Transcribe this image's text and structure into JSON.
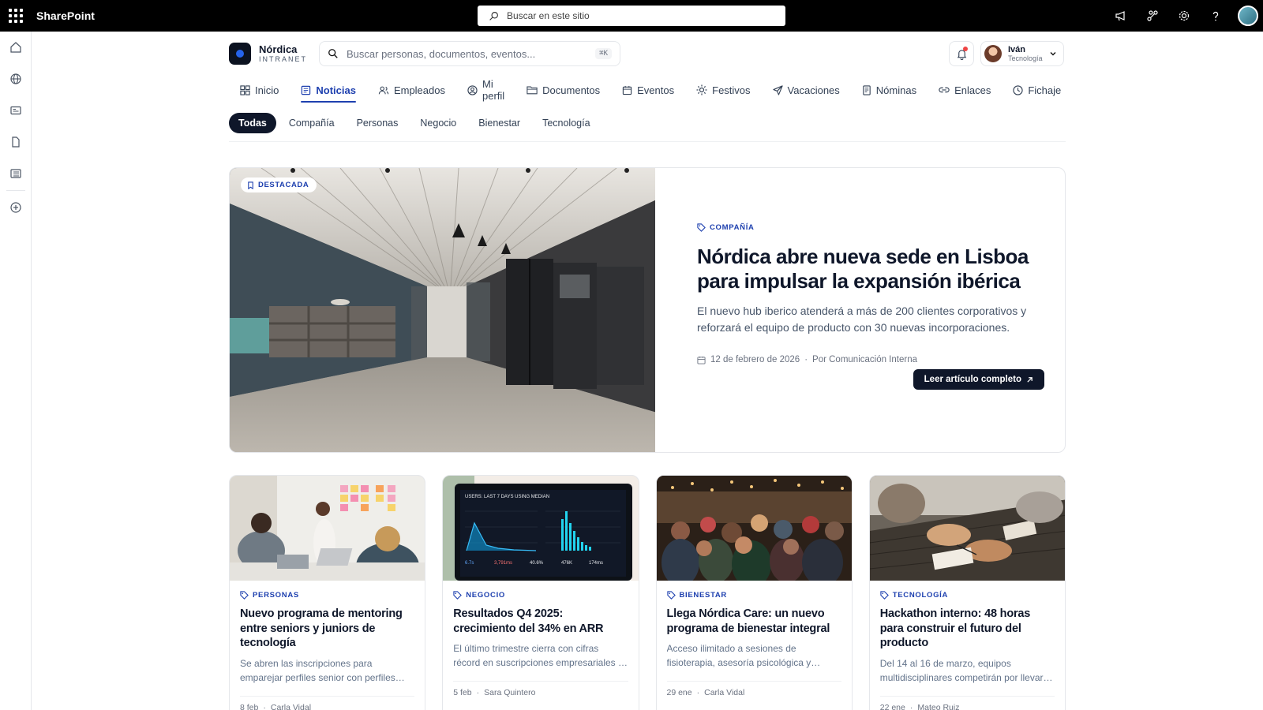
{
  "sp": {
    "title": "SharePoint",
    "search_placeholder": "Buscar en este sitio"
  },
  "brand": {
    "name": "Nórdica",
    "sub": "INTRANET"
  },
  "search": {
    "placeholder": "Buscar personas, documentos, eventos...",
    "shortcut": "⌘K"
  },
  "user": {
    "name": "Iván",
    "department": "Tecnología"
  },
  "nav": [
    {
      "label": "Inicio",
      "icon": "grid-icon"
    },
    {
      "label": "Noticias",
      "icon": "newspaper-icon",
      "active": true
    },
    {
      "label": "Empleados",
      "icon": "users-icon"
    },
    {
      "label": "Mi perfil",
      "icon": "user-circle-icon"
    },
    {
      "label": "Documentos",
      "icon": "folder-icon"
    },
    {
      "label": "Eventos",
      "icon": "calendar-icon"
    },
    {
      "label": "Festivos",
      "icon": "sun-icon"
    },
    {
      "label": "Vacaciones",
      "icon": "plane-icon"
    },
    {
      "label": "Nóminas",
      "icon": "receipt-icon"
    },
    {
      "label": "Enlaces",
      "icon": "link-icon"
    },
    {
      "label": "Fichaje",
      "icon": "clock-icon"
    }
  ],
  "filters": [
    "Todas",
    "Compañía",
    "Personas",
    "Negocio",
    "Bienestar",
    "Tecnología"
  ],
  "featured": {
    "badge": "DESTACADA",
    "tag": "COMPAÑÍA",
    "title": "Nórdica abre nueva sede en Lisboa para impulsar la expansión ibérica",
    "description": "El nuevo hub iberico atenderá a más de 200 clientes corporativos y reforzará el equipo de producto con 30 nuevas incorporaciones.",
    "date": "12 de febrero de 2026",
    "author": "Por Comunicación Interna",
    "cta": "Leer artículo completo"
  },
  "cards": [
    {
      "tag": "PERSONAS",
      "title": "Nuevo programa de mentoring entre seniors y juniors de tecnología",
      "description": "Se abren las inscripciones para emparejar perfiles senior con perfiles junior de todas las áreas.",
      "date": "8 feb",
      "author": "Carla Vidal"
    },
    {
      "tag": "NEGOCIO",
      "title": "Resultados Q4 2025: crecimiento del 34% en ARR",
      "description": "El último trimestre cierra con cifras récord en suscripciones empresariales y expansión internacional.",
      "date": "5 feb",
      "author": "Sara Quintero"
    },
    {
      "tag": "BIENESTAR",
      "title": "Llega Nórdica Care: un nuevo programa de bienestar integral",
      "description": "Acceso ilimitado a sesiones de fisioterapia, asesoría psicológica y nutrición para toda la plantilla.",
      "date": "29 ene",
      "author": "Carla Vidal"
    },
    {
      "tag": "TECNOLOGÍA",
      "title": "Hackathon interno: 48 horas para construir el futuro del producto",
      "description": "Del 14 al 16 de marzo, equipos multidisciplinares competirán por llevar su idea al roadmap.",
      "date": "22 ene",
      "author": "Mateo Ruiz"
    }
  ],
  "colors": {
    "accent": "#1e40af",
    "dark": "#0f172a",
    "notification": "#ef4444"
  }
}
